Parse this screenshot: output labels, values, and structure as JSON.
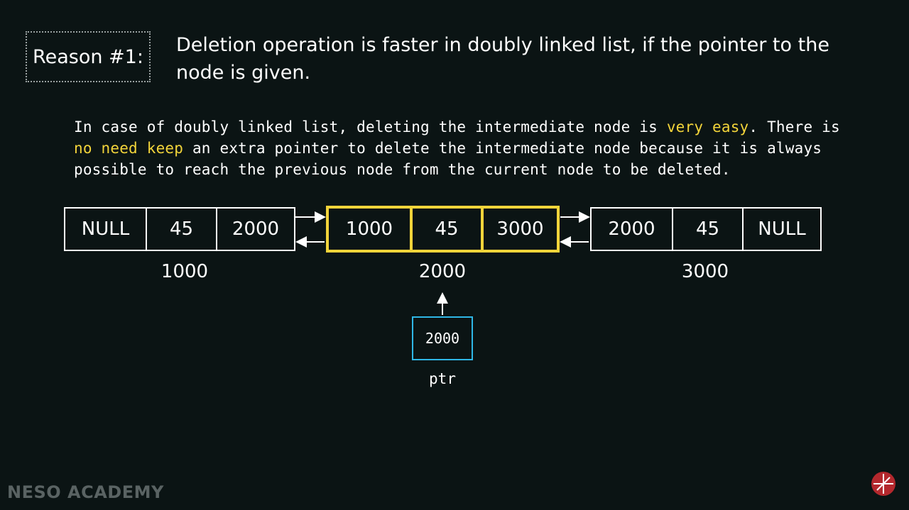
{
  "reason_label": "Reason #1:",
  "reason_text": "Deletion operation is faster in doubly linked list, if the pointer to the node is given.",
  "paragraph": {
    "p1": "In case of doubly linked list, deleting the intermediate node is ",
    "h1": "very easy",
    "p2": ". There is ",
    "h2": "no need keep",
    "p3": " an extra pointer to delete the intermediate node because it is always possible to reach the previous node from the current node to be deleted."
  },
  "nodes": [
    {
      "prev": "NULL",
      "data": "45",
      "next": "2000",
      "address": "1000"
    },
    {
      "prev": "1000",
      "data": "45",
      "next": "3000",
      "address": "2000"
    },
    {
      "prev": "2000",
      "data": "45",
      "next": "NULL",
      "address": "3000"
    }
  ],
  "pointer": {
    "value": "2000",
    "label": "ptr"
  },
  "brand": "NESO ACADEMY",
  "colors": {
    "highlight": "#f2d43a",
    "pointer_box": "#2fb7e6",
    "background": "#0b1414",
    "logo": "#b3282d"
  }
}
